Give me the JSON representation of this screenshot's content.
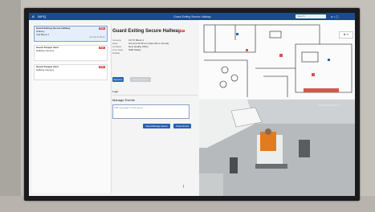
{
  "app": {
    "name": "SAFIQ",
    "window_title": "Guard Exiting Secure Hallway",
    "search_placeholder": "Search"
  },
  "list": {
    "items": [
      {
        "title": "Guard Exiting Secure Hallway",
        "subtitle": "Hallway",
        "location": "Cell Block 4",
        "badge": "High",
        "time": "Oct 2nd 11:05 am"
      },
      {
        "title": "Guard Tamper Alert",
        "subtitle": "Hallway Camera",
        "location": "",
        "badge": "High",
        "time": ""
      },
      {
        "title": "Guard Tamper Alert",
        "subtitle": "Hallway Camera",
        "location": "",
        "badge": "Med",
        "time": ""
      }
    ]
  },
  "detail": {
    "title": "Guard Exiting Secure Hallway",
    "badge": "High",
    "fields": [
      {
        "k": "Camera",
        "v": "CCTV Block 4"
      },
      {
        "k": "Date",
        "v": "Oct 2nd 11:05 am (Saw this in format)"
      },
      {
        "k": "Location",
        "v": "New Quality Office"
      },
      {
        "k": "Live Case",
        "v": "Staff Safety"
      },
      {
        "k": "Details",
        "v": ""
      }
    ],
    "approve_label": "Approve",
    "dismiss_label": "Dismiss Event",
    "logs_label": "Logs",
    "manage_events_label": "Manage Events",
    "note_placeholder": "Add message to this event...",
    "save_label": "Save/Manage Event",
    "close_label": "Close Event"
  },
  "camera": {
    "overlay": "CAM 04  2024-10-02"
  },
  "colors": {
    "brand": "#1c4a8d",
    "accent": "#2563b5",
    "alert": "#d9534f"
  }
}
